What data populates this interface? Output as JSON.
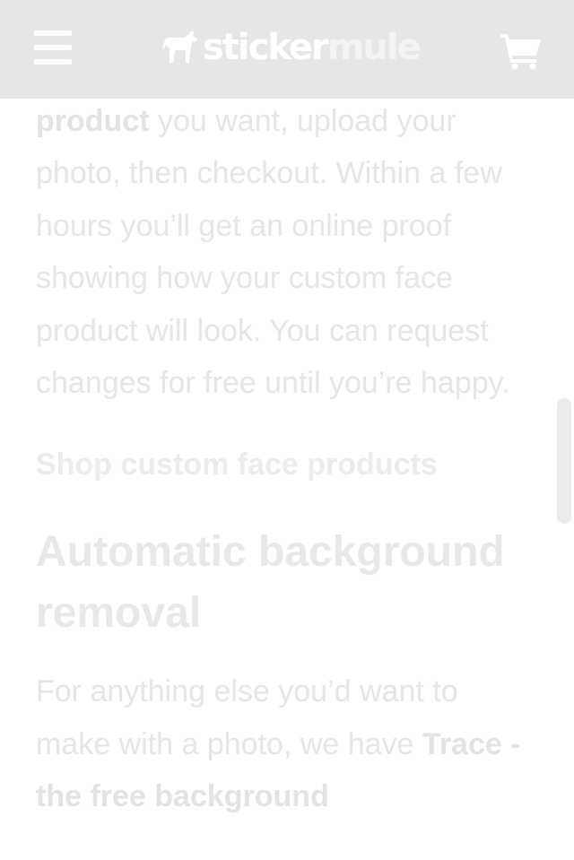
{
  "header": {
    "logo": {
      "word1": "sticker",
      "word2": "mule"
    },
    "menu_icon": "hamburger-menu-icon",
    "cart_icon": "shopping-cart-icon"
  },
  "content": {
    "para1": {
      "lead_bold": "product",
      "text": " you want, upload your photo, then checkout. Within a few hours you’ll get an online proof showing how your custom face product will look. You can request changes for free until you’re happy."
    },
    "shop_link": "Shop custom face products",
    "section_heading": "Automatic background removal",
    "para2": {
      "text": "For anything else you’d want to make with a photo, we have ",
      "trailing_bold": "Trace - the free background"
    }
  },
  "colors": {
    "header_bg": "#e6e6e6",
    "text": "#e6e6e6",
    "scrollbar": "#ebebeb"
  }
}
